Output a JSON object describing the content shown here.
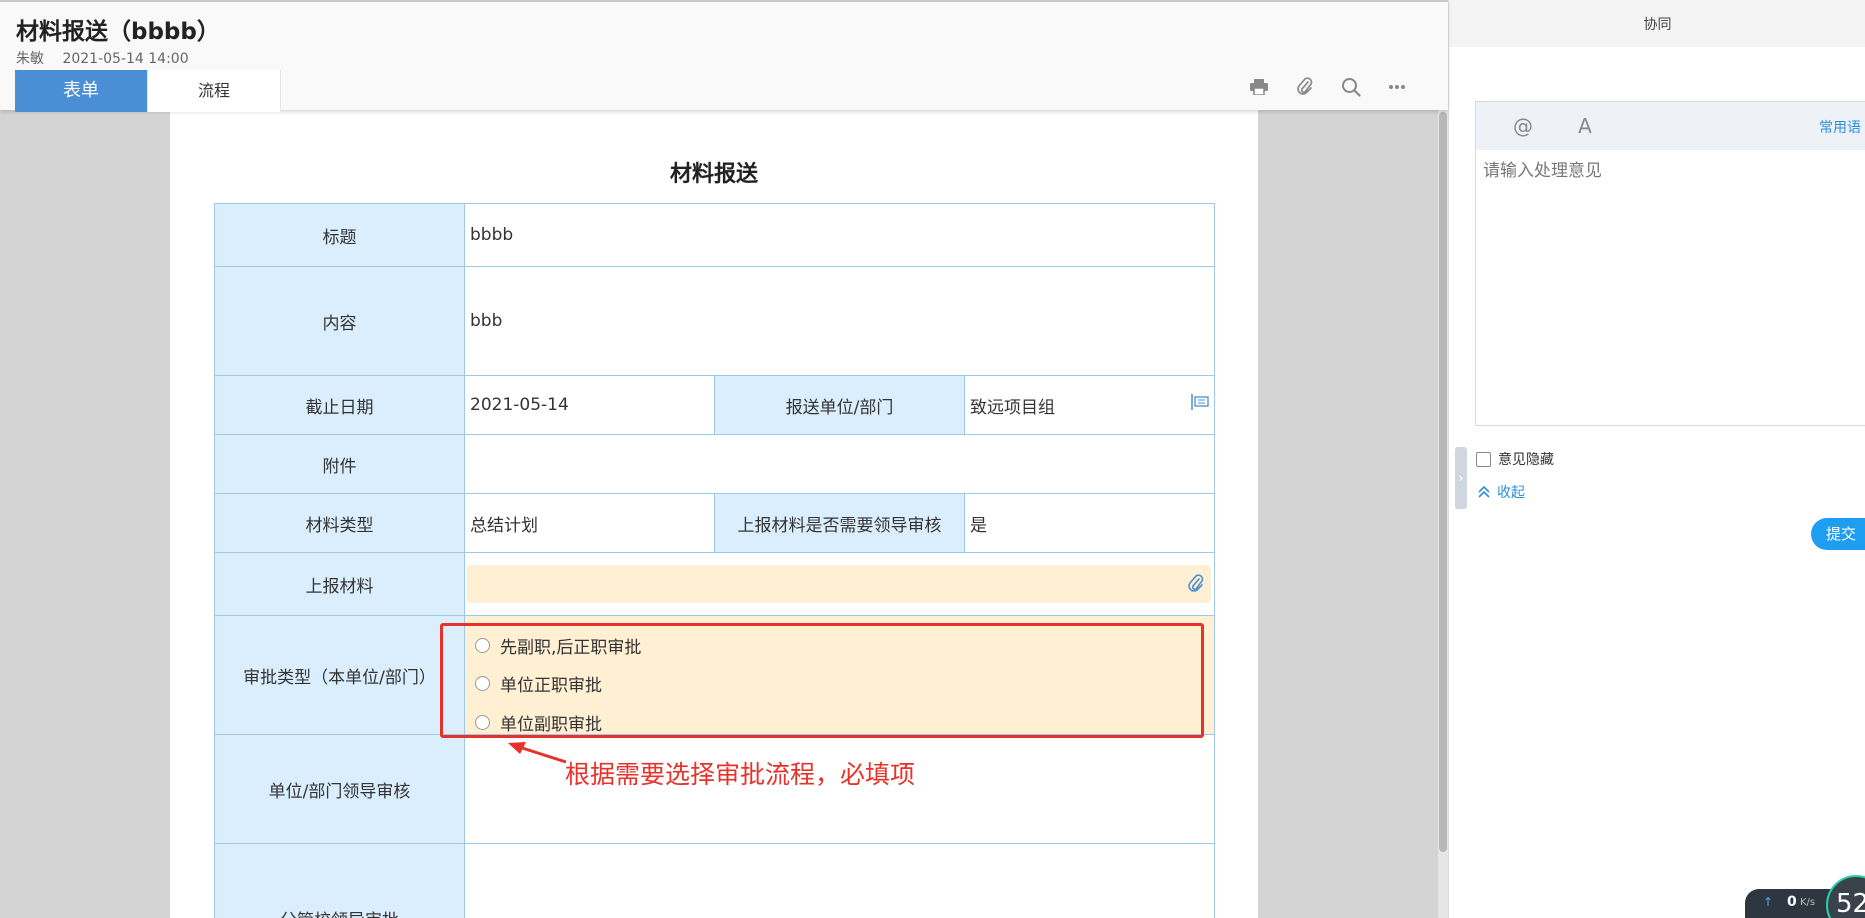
{
  "header": {
    "title": "材料报送（bbbb）",
    "author": "朱敏",
    "datetime": "2021-05-14 14:00",
    "tabs": [
      "表单",
      "流程"
    ]
  },
  "icons": {
    "print": "print-icon",
    "attach": "paperclip-icon",
    "search": "search-icon",
    "more": "more-icon",
    "assistant": "robot-icon"
  },
  "form": {
    "title": "材料报送",
    "labels": {
      "title": "标题",
      "content": "内容",
      "deadline": "截止日期",
      "dept": "报送单位/部门",
      "attachment": "附件",
      "type": "材料类型",
      "review_needed": "上报材料是否需要领导审核",
      "materials": "上报材料",
      "approval_type": "审批类型（本单位/部门）",
      "dept_leader": "单位/部门领导审核",
      "campus_leader": "分管校领导审批"
    },
    "values": {
      "title": "bbbb",
      "content": "bbb",
      "deadline": "2021-05-14",
      "dept": "致远项目组",
      "type": "总结计划",
      "review_needed": "是"
    },
    "approval_options": [
      "先副职,后正职审批",
      "单位正职审批",
      "单位副职审批"
    ]
  },
  "annotation": {
    "text": "根据需要选择审批流程，必填项",
    "color": "#e8312a"
  },
  "right_panel": {
    "header": "协同",
    "at_tool": "@",
    "font_tool": "A",
    "common_phrases": "常用语",
    "opinion_placeholder": "请输入处理意见",
    "hide_opinion": "意见隐藏",
    "collapse": "收起",
    "submit": "提交"
  },
  "speed_widget": {
    "value": "0",
    "unit": "K/s",
    "circle": "52"
  },
  "colors": {
    "tab_active": "#4a8fd6",
    "label_bg": "#dbeefd",
    "required_bg": "#fff0d3",
    "border": "#9ec7e8",
    "link": "#2a8fe0",
    "submit": "#1e9ef0"
  }
}
